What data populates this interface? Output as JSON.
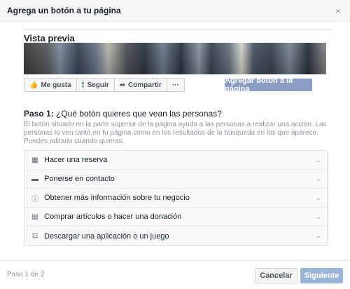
{
  "modal": {
    "title": "Agrega un botón a tu página",
    "close_icon": "×"
  },
  "preview": {
    "label": "Vista previa",
    "actions": [
      {
        "icon": "👍",
        "label": "Me gusta"
      },
      {
        "icon": "⟟",
        "label": "Seguir"
      },
      {
        "icon": "➦",
        "label": "Compartir"
      },
      {
        "icon": "",
        "label": "···"
      }
    ],
    "add_button": "Agregar botón a la página"
  },
  "step": {
    "prefix": "Paso 1:",
    "question": " ¿Qué botón quieres que vean las personas?",
    "description": "El botón situado en la parte superior de la página ayuda a las personas a realizar una acción. Las personas lo ven tanto en tu página como en los resultados de la búsqueda en los que aparece. Puedes editarlo cuando quieras."
  },
  "options": [
    {
      "icon": "▦",
      "label": "Hacer una reserva"
    },
    {
      "icon": "▬",
      "label": "Ponerse en contacto"
    },
    {
      "icon": "ⓘ",
      "label": "Obtener más información sobre tu negocio"
    },
    {
      "icon": "▤",
      "label": "Comprar artículos o hacer una donación"
    },
    {
      "icon": "⊡",
      "label": "Descargar una aplicación o un juego"
    }
  ],
  "footer": {
    "step_count": "Paso 1 de 2",
    "cancel": "Cancelar",
    "next": "Siguiente"
  }
}
